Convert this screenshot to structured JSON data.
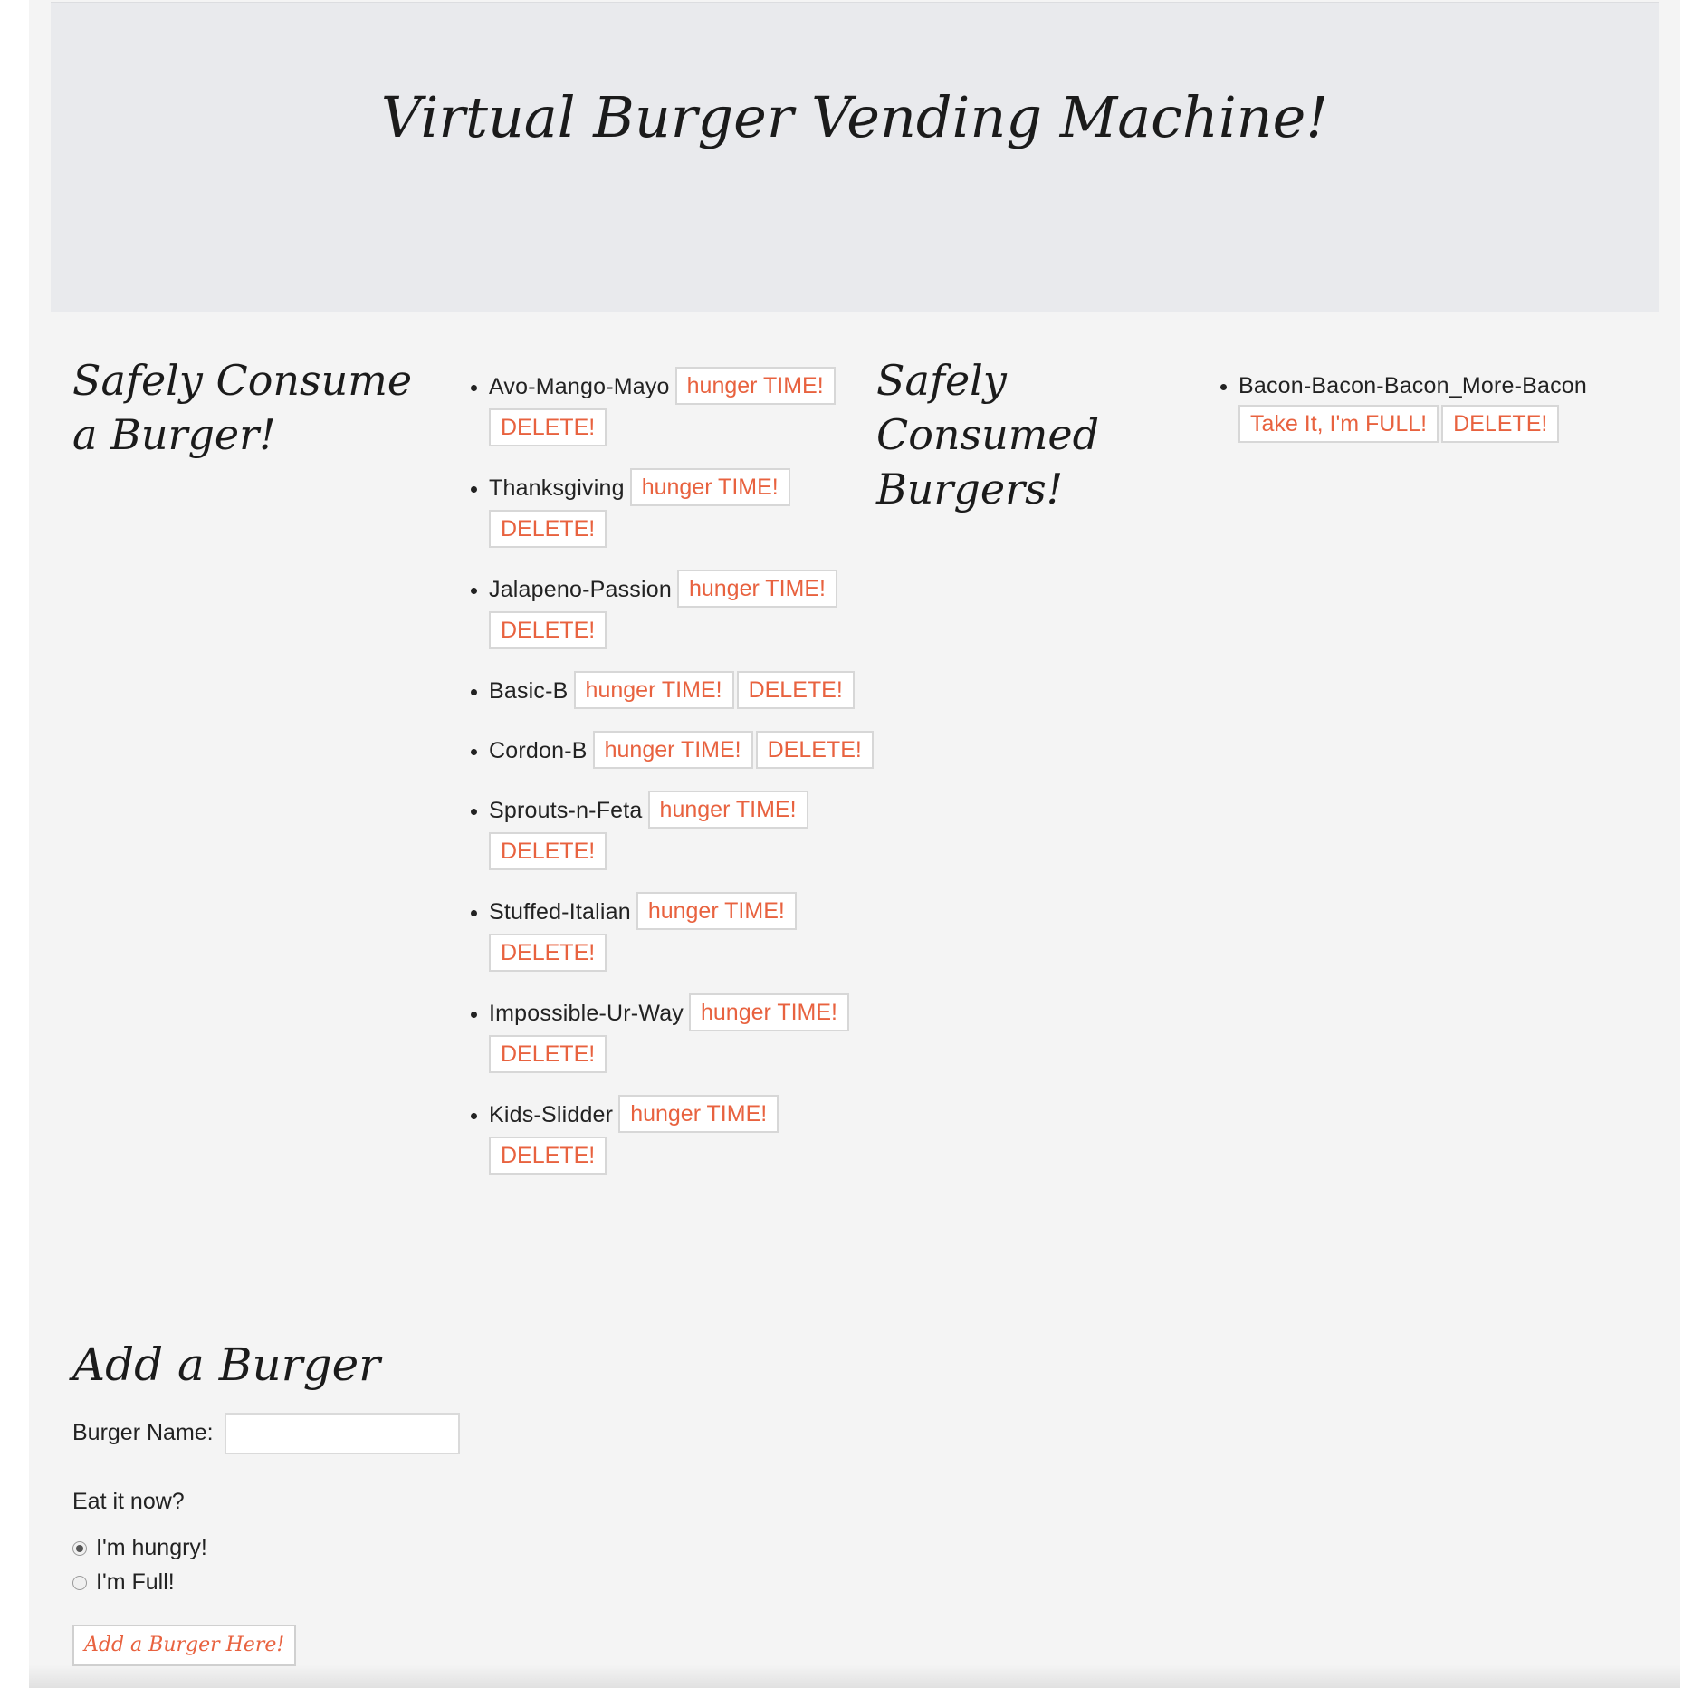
{
  "header": {
    "title": "Virtual Burger Vending Machine!"
  },
  "devour_section": {
    "heading_line1": "Safely Consume",
    "heading_line2": "a Burger!",
    "items": [
      {
        "name": "Avo-Mango-Mayo",
        "devour_label": "hunger TIME!",
        "delete_label": "DELETE!"
      },
      {
        "name": "Thanksgiving",
        "devour_label": "hunger TIME!",
        "delete_label": "DELETE!"
      },
      {
        "name": "Jalapeno-Passion",
        "devour_label": "hunger TIME!",
        "delete_label": "DELETE!"
      },
      {
        "name": "Basic-B",
        "devour_label": "hunger TIME!",
        "delete_label": "DELETE!"
      },
      {
        "name": "Cordon-B",
        "devour_label": "hunger TIME!",
        "delete_label": "DELETE!"
      },
      {
        "name": "Sprouts-n-Feta",
        "devour_label": "hunger TIME!",
        "delete_label": "DELETE!"
      },
      {
        "name": "Stuffed-Italian",
        "devour_label": "hunger TIME!",
        "delete_label": "DELETE!"
      },
      {
        "name": "Impossible-Ur-Way",
        "devour_label": "hunger TIME!",
        "delete_label": "DELETE!"
      },
      {
        "name": "Kids-Slidder",
        "devour_label": "hunger TIME!",
        "delete_label": "DELETE!"
      }
    ]
  },
  "devoured_section": {
    "heading_line1": "Safely",
    "heading_line2": "Consumed",
    "heading_line3": "Burgers!",
    "items": [
      {
        "name": "Bacon-Bacon-Bacon_More-Bacon",
        "undo_label": "Take It, I'm FULL!",
        "delete_label": "DELETE!"
      }
    ]
  },
  "add_form": {
    "heading": "Add a Burger",
    "name_label": "Burger Name:",
    "name_value": "",
    "eat_question": "Eat it now?",
    "option_hungry": "I'm hungry!",
    "option_full": "I'm Full!",
    "selected_option": "hungry",
    "submit_label": "Add a Burger Here!"
  },
  "colors": {
    "accent": "#e8623f",
    "page_background": "#f4f4f4",
    "header_background": "#e9eaed"
  }
}
